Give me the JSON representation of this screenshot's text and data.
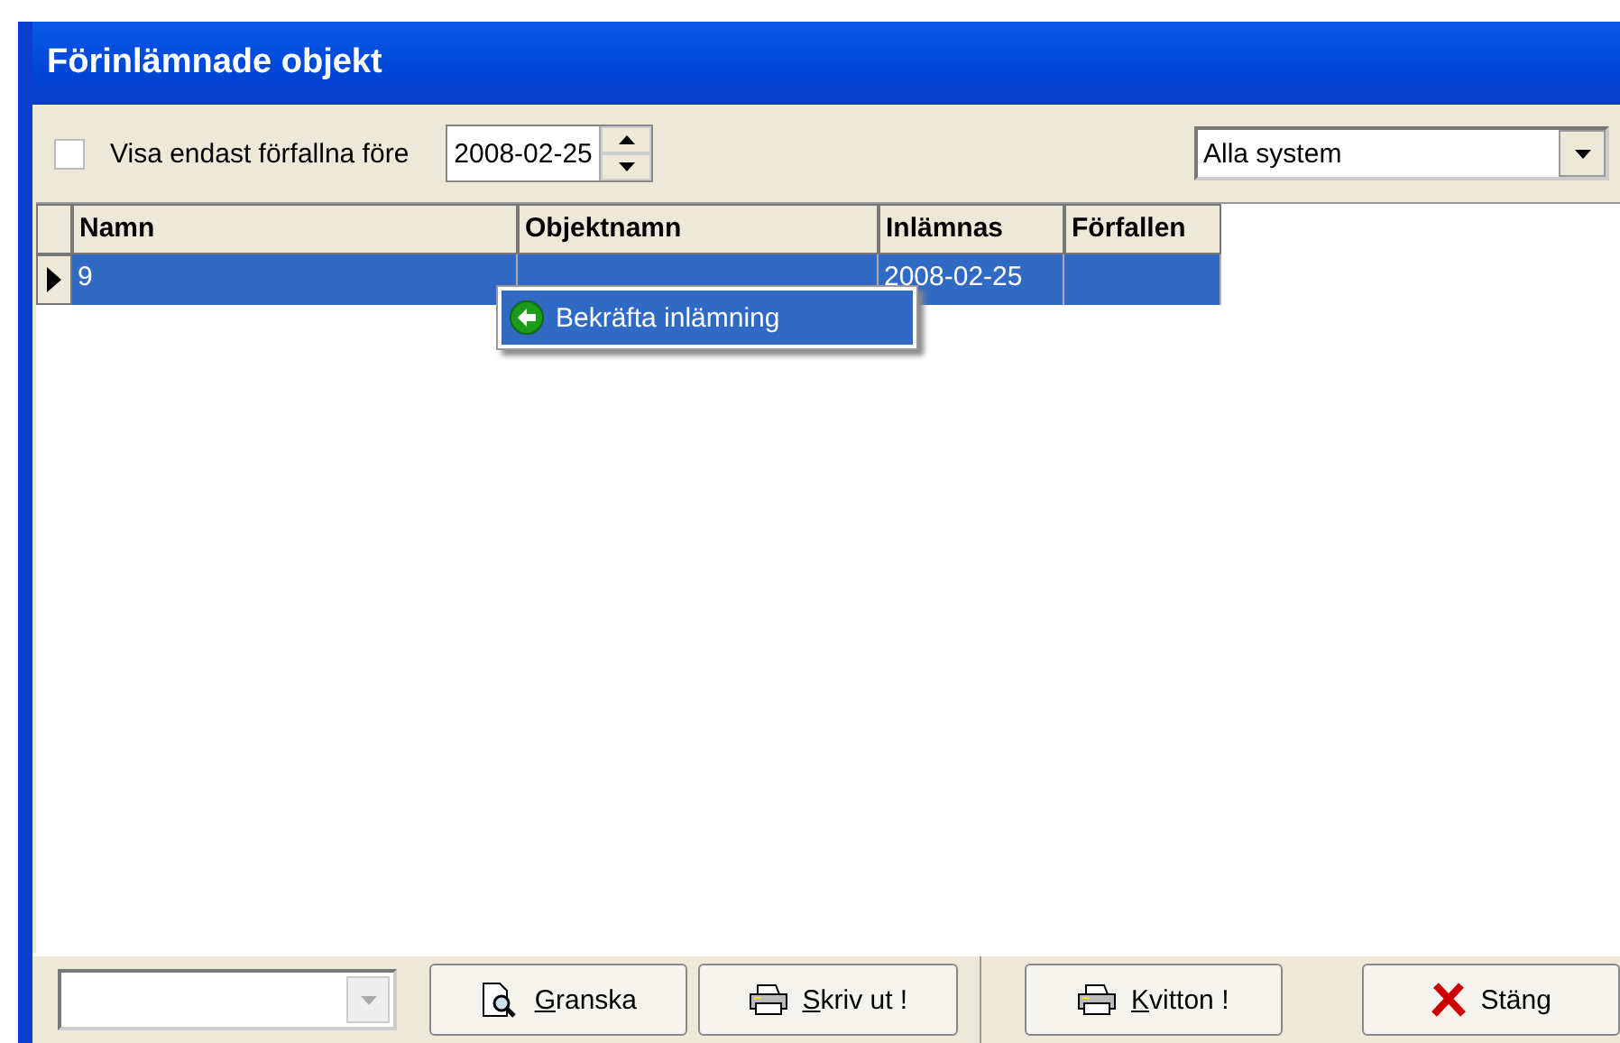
{
  "window": {
    "title": "Förinlämnade objekt"
  },
  "filter": {
    "checkbox": {
      "label": "Visa endast förfallna före",
      "checked": false
    },
    "date": "2008-02-25",
    "system": "Alla system"
  },
  "table": {
    "columns": [
      "Namn",
      "Objektnamn",
      "Inlämnas",
      "Förfallen"
    ],
    "rows": [
      {
        "cells": [
          "9",
          "",
          "2008-02-25",
          ""
        ],
        "selected": true
      }
    ]
  },
  "context_menu": {
    "items": [
      {
        "label": "Bekräfta inlämning",
        "selected": true
      }
    ]
  },
  "bottom_bar": {
    "buttons": [
      {
        "label": "Granska",
        "kind": "preview"
      },
      {
        "label": "Skriv ut !",
        "kind": "print"
      },
      {
        "label": "Kvitton !",
        "kind": "print"
      },
      {
        "label": "Stäng",
        "kind": "close"
      }
    ]
  }
}
